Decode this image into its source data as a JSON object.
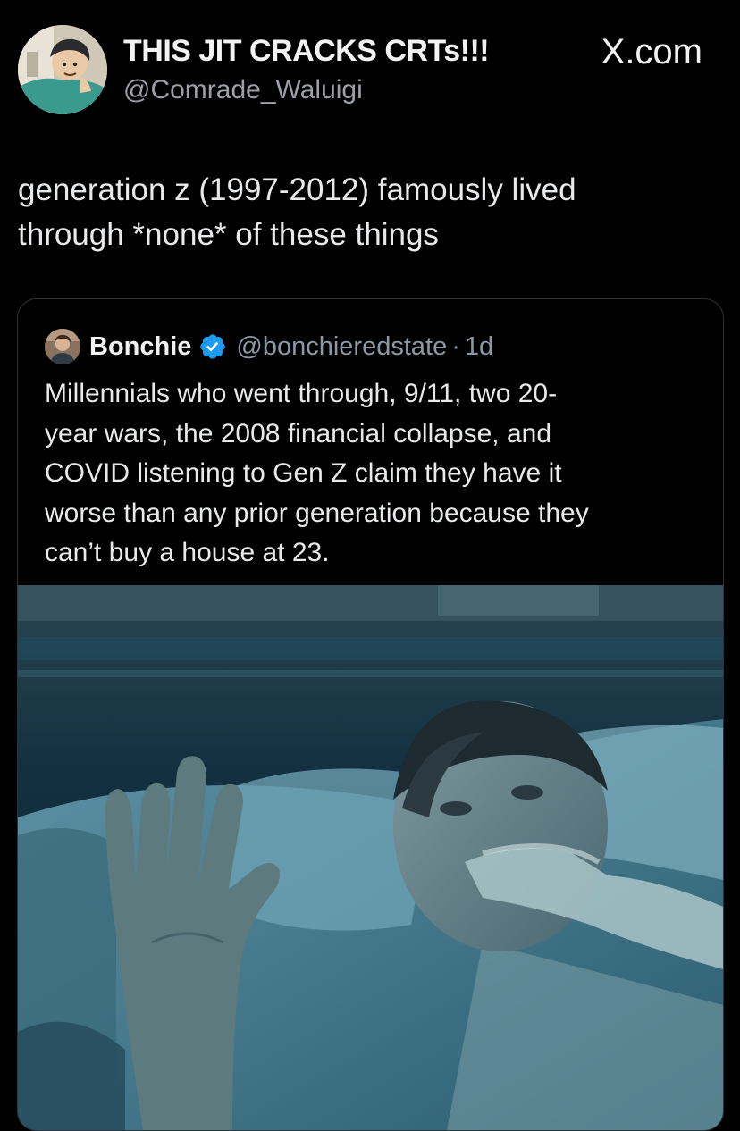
{
  "post": {
    "author": {
      "display_name": "THIS JIT CRACKS CRTs!!!",
      "handle": "@Comrade_Waluigi",
      "avatar_icon": "cartoon-avatar"
    },
    "brand": "X.com",
    "text": "generation z (1997-2012) famously lived\nthrough *none* of these things"
  },
  "quote": {
    "author": {
      "display_name": "Bonchie",
      "handle": "@bonchieredstate",
      "separator": "·",
      "time": "1d",
      "verified": true,
      "verified_icon": "verified-badge-icon",
      "avatar_icon": "photo-avatar"
    },
    "text": "Millennials who went through, 9/11, two 20-\nyear wars, the 2008 financial collapse, and\nCOVID listening to Gen Z claim they have it\nworse than any prior generation because they\ncan’t buy a house at 23.",
    "media": {
      "type": "image",
      "subject": "hospital-bed-scene"
    }
  },
  "colors": {
    "background": "#000000",
    "text_primary": "#e7e9ea",
    "text_secondary": "#8b98a5",
    "border": "#2f3336",
    "verified_blue": "#1d9bf0"
  }
}
